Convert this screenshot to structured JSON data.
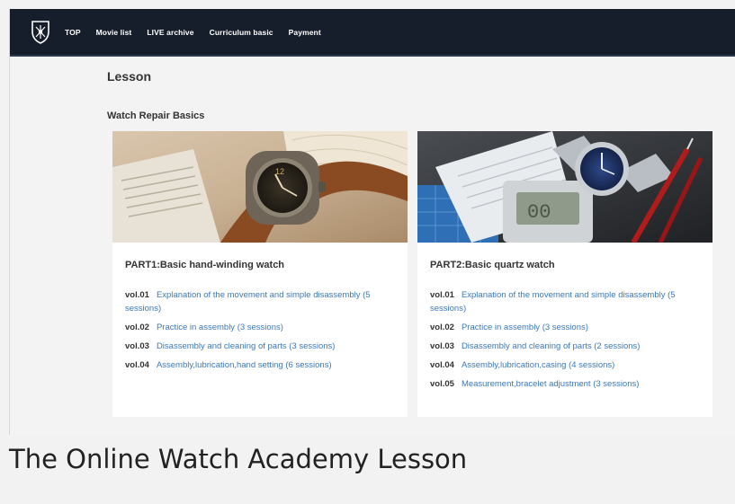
{
  "nav": {
    "items": [
      {
        "label": "TOP"
      },
      {
        "label": "Movie list"
      },
      {
        "label": "LIVE archive"
      },
      {
        "label": "Curriculum basic"
      },
      {
        "label": "Payment"
      }
    ]
  },
  "page": {
    "title": "Lesson",
    "section_title": "Watch Repair Basics"
  },
  "courses": [
    {
      "part_title": "PART1:Basic hand-winding watch",
      "lessons": [
        {
          "vol": "vol.01",
          "title": "Explanation of the movement and simple disassembly (5 sessions)"
        },
        {
          "vol": "vol.02",
          "title": "Practice in assembly (3 sessions)"
        },
        {
          "vol": "vol.03",
          "title": "Disassembly and cleaning of parts (3 sessions)"
        },
        {
          "vol": "vol.04",
          "title": "Assembly,lubrication,hand setting (6 sessions)"
        }
      ]
    },
    {
      "part_title": "PART2:Basic quartz watch",
      "lessons": [
        {
          "vol": "vol.01",
          "title": "Explanation of the movement and simple disassembly (5 sessions)"
        },
        {
          "vol": "vol.02",
          "title": "Practice in assembly (3 sessions)"
        },
        {
          "vol": "vol.03",
          "title": "Disassembly and cleaning of parts (2 sessions)"
        },
        {
          "vol": "vol.04",
          "title": "Assembly,lubrication,casing (4 sessions)"
        },
        {
          "vol": "vol.05",
          "title": "Measurement,bracelet adjustment (3 sessions)"
        }
      ]
    }
  ],
  "caption": "The Online Watch Academy Lesson",
  "colors": {
    "navbar": "#161e2b",
    "link": "#3a78b8",
    "text": "#333333",
    "background": "#f3f3f3"
  },
  "icons": {
    "logo": "shield-crest-icon"
  }
}
